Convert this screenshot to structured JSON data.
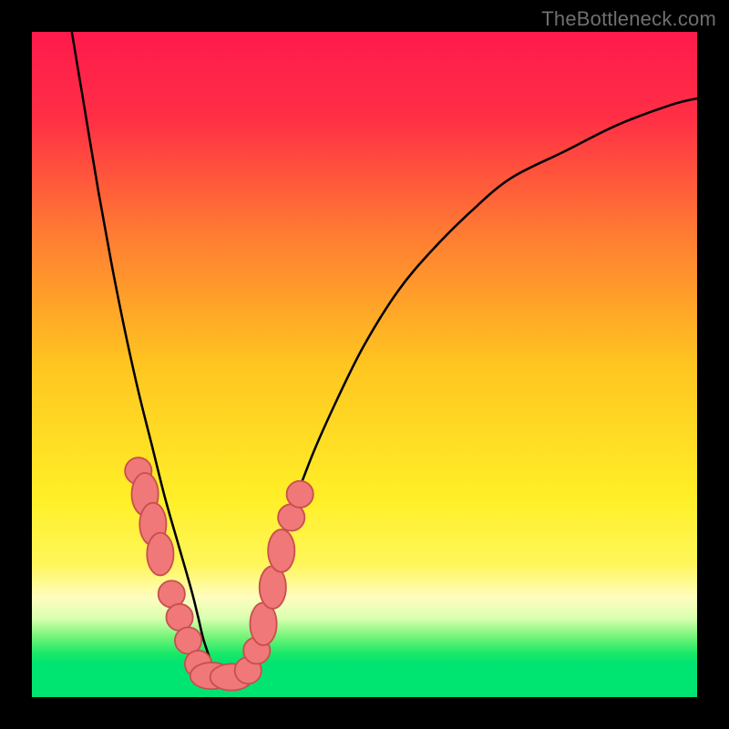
{
  "watermark": "TheBottleneck.com",
  "chart_data": {
    "type": "line",
    "title": "",
    "xlabel": "",
    "ylabel": "",
    "xlim": [
      0,
      100
    ],
    "ylim": [
      0,
      100
    ],
    "grid": false,
    "legend": false,
    "color_gradient_stops": [
      {
        "offset": 0.0,
        "color": "#ff1a4d"
      },
      {
        "offset": 0.13,
        "color": "#ff2f45"
      },
      {
        "offset": 0.3,
        "color": "#ff7a33"
      },
      {
        "offset": 0.5,
        "color": "#ffc520"
      },
      {
        "offset": 0.7,
        "color": "#ffef27"
      },
      {
        "offset": 0.8,
        "color": "#fff65a"
      },
      {
        "offset": 0.85,
        "color": "#fffdbf"
      },
      {
        "offset": 0.882,
        "color": "#d9ffb0"
      },
      {
        "offset": 0.908,
        "color": "#78f57a"
      },
      {
        "offset": 0.935,
        "color": "#18e867"
      },
      {
        "offset": 0.95,
        "color": "#00e472"
      },
      {
        "offset": 1.0,
        "color": "#00e472"
      }
    ],
    "series": [
      {
        "name": "bottleneck-curve",
        "color": "#000000",
        "x": [
          6,
          8,
          10,
          12,
          14,
          16,
          18,
          20,
          22,
          24,
          25,
          26,
          28,
          30,
          32,
          34,
          36,
          38,
          42,
          46,
          50,
          55,
          60,
          66,
          72,
          80,
          88,
          96,
          100
        ],
        "y": [
          100,
          88,
          76,
          65,
          55,
          46,
          38,
          30,
          23,
          16,
          12,
          8,
          3,
          3,
          5,
          11,
          18,
          25,
          36,
          45,
          53,
          61,
          67,
          73,
          78,
          82,
          86,
          89,
          90
        ]
      }
    ],
    "markers": {
      "color": "#f07878",
      "stroke": "#c94f4f",
      "points": [
        {
          "x": 16.0,
          "y": 34.0,
          "rx": 2.0,
          "ry": 2.0
        },
        {
          "x": 17.0,
          "y": 30.5,
          "rx": 2.0,
          "ry": 3.2
        },
        {
          "x": 18.2,
          "y": 26.0,
          "rx": 2.0,
          "ry": 3.2
        },
        {
          "x": 19.3,
          "y": 21.5,
          "rx": 2.0,
          "ry": 3.2
        },
        {
          "x": 21.0,
          "y": 15.5,
          "rx": 2.0,
          "ry": 2.0
        },
        {
          "x": 22.2,
          "y": 12.0,
          "rx": 2.0,
          "ry": 2.0
        },
        {
          "x": 23.5,
          "y": 8.5,
          "rx": 2.0,
          "ry": 2.0
        },
        {
          "x": 25.0,
          "y": 5.0,
          "rx": 2.0,
          "ry": 2.0
        },
        {
          "x": 27.0,
          "y": 3.2,
          "rx": 3.2,
          "ry": 2.0
        },
        {
          "x": 30.0,
          "y": 3.0,
          "rx": 3.2,
          "ry": 2.0
        },
        {
          "x": 32.5,
          "y": 4.0,
          "rx": 2.0,
          "ry": 2.0
        },
        {
          "x": 33.8,
          "y": 7.0,
          "rx": 2.0,
          "ry": 2.0
        },
        {
          "x": 34.8,
          "y": 11.0,
          "rx": 2.0,
          "ry": 3.2
        },
        {
          "x": 36.2,
          "y": 16.5,
          "rx": 2.0,
          "ry": 3.2
        },
        {
          "x": 37.5,
          "y": 22.0,
          "rx": 2.0,
          "ry": 3.2
        },
        {
          "x": 39.0,
          "y": 27.0,
          "rx": 2.0,
          "ry": 2.0
        },
        {
          "x": 40.3,
          "y": 30.5,
          "rx": 2.0,
          "ry": 2.0
        }
      ]
    }
  }
}
